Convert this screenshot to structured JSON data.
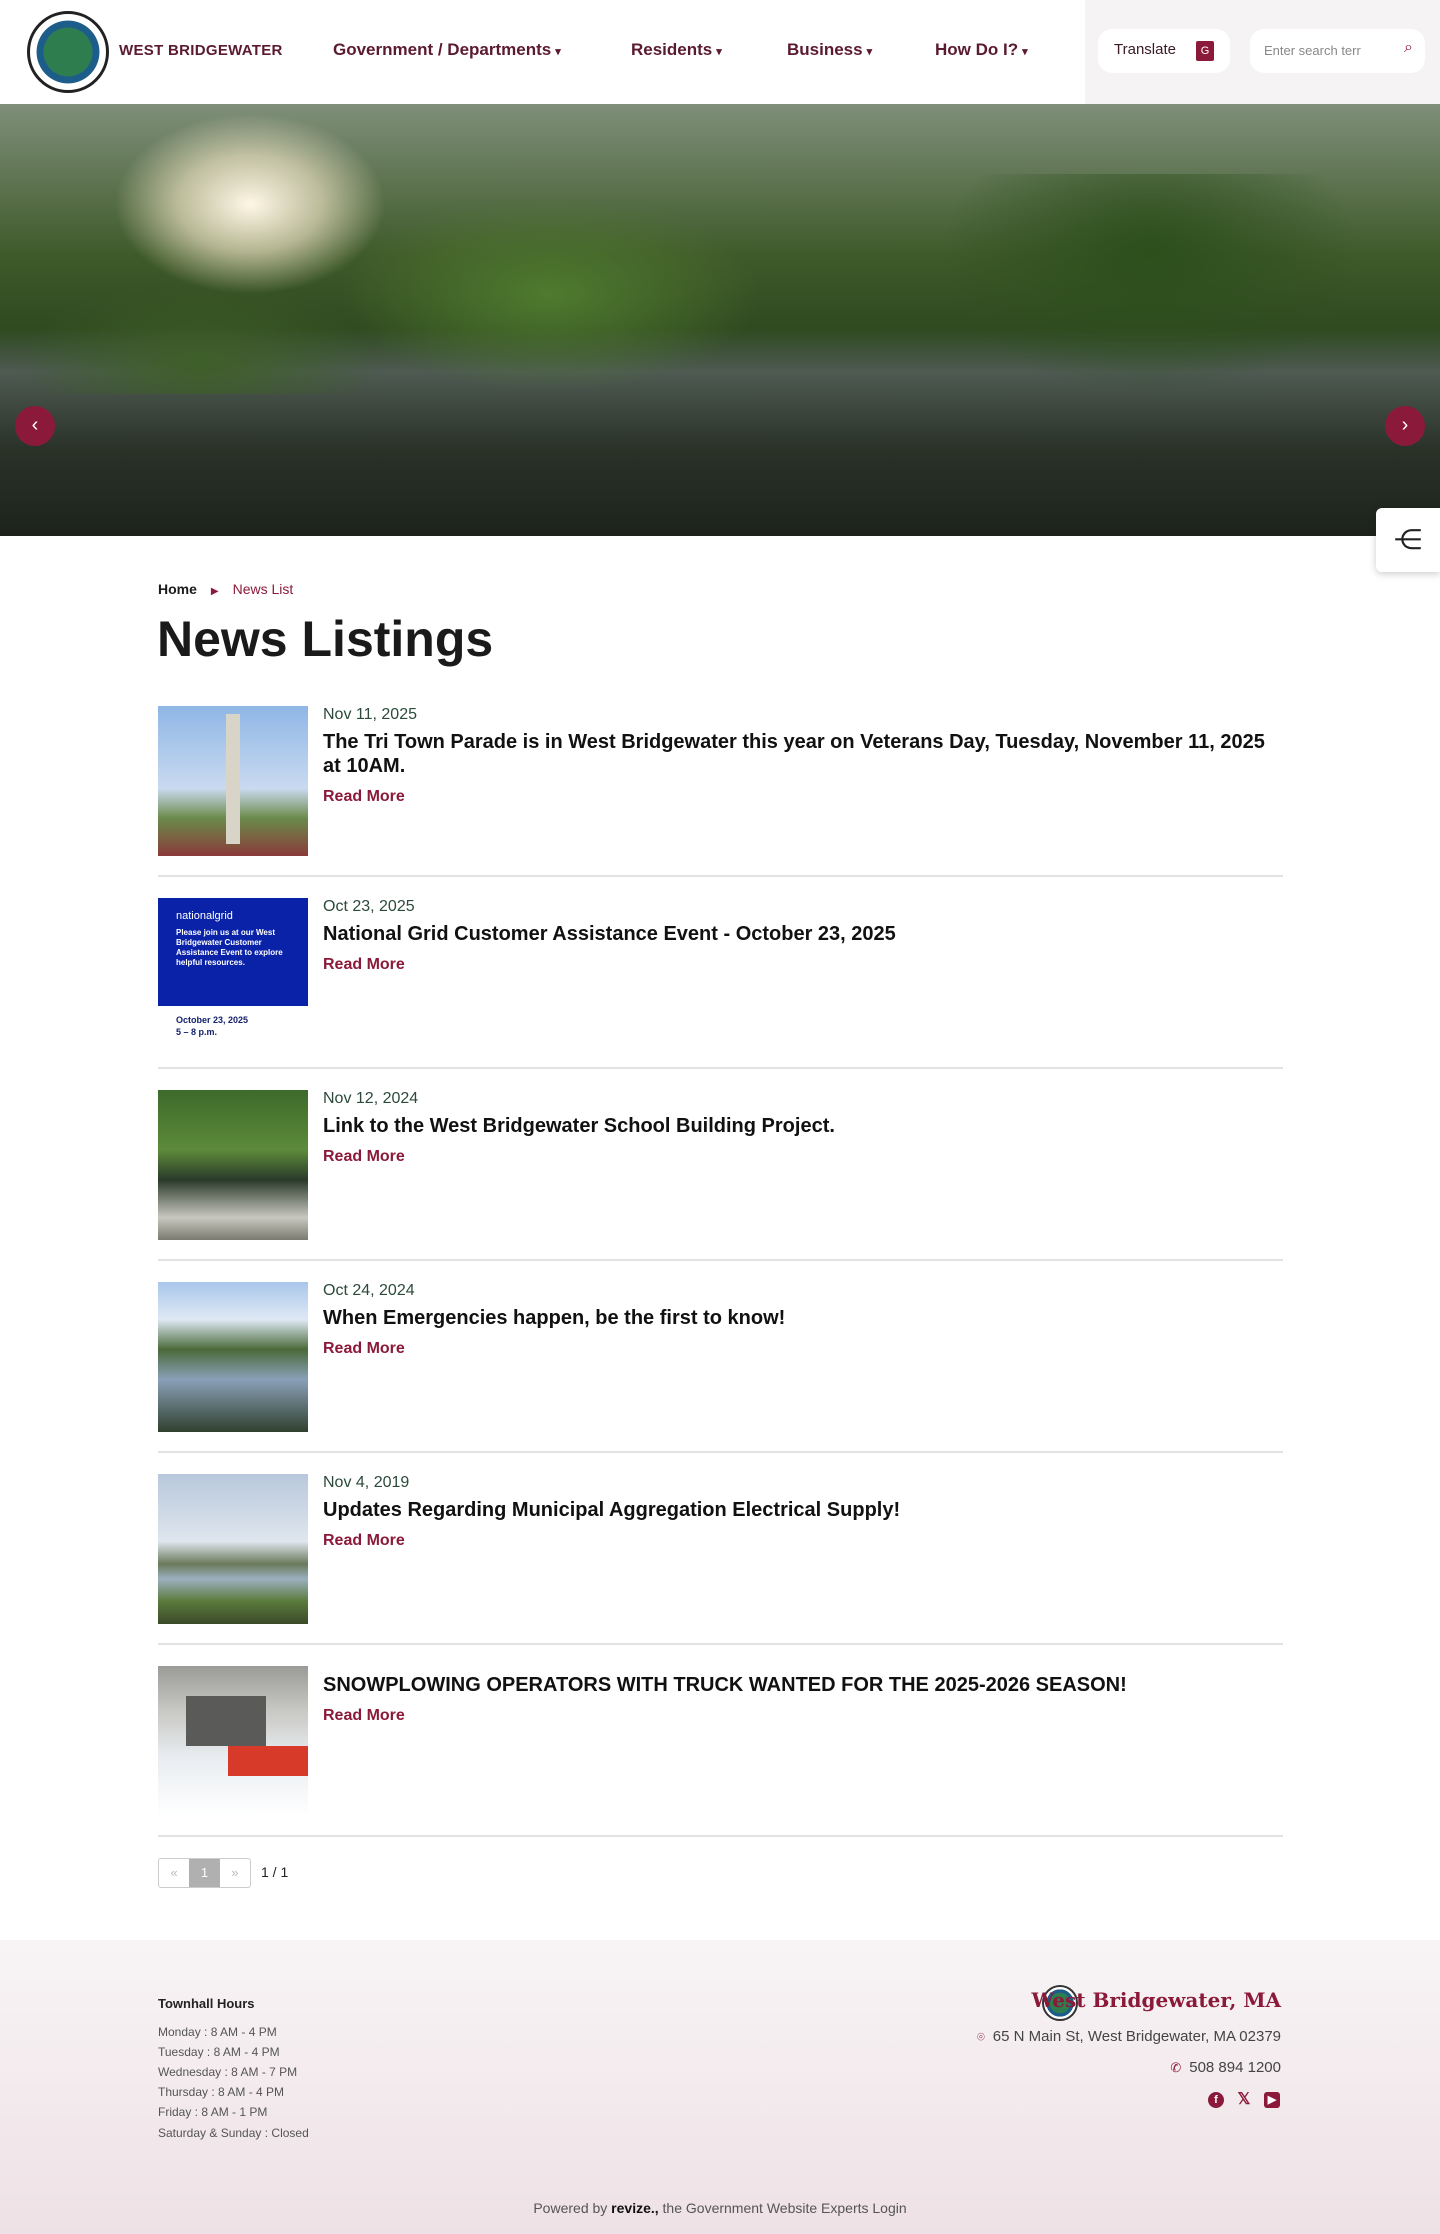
{
  "header": {
    "brand": "WEST BRIDGEWATER",
    "nav": [
      {
        "label": "Government / Departments"
      },
      {
        "label": "Residents"
      },
      {
        "label": "Business"
      },
      {
        "label": "How Do I?"
      }
    ],
    "translate": "Translate",
    "search_placeholder": "Enter search terr"
  },
  "breadcrumb": {
    "home": "Home",
    "current": "News List"
  },
  "page_title": "News Listings",
  "news": [
    {
      "date": "Nov 11, 2025",
      "title": "The Tri Town Parade is in West Bridgewater this year on Veterans Day, Tuesday, November 11, 2025 at 10AM.",
      "link": "Read More"
    },
    {
      "date": "Oct 23, 2025",
      "title": "National Grid Customer Assistance Event - October 23, 2025",
      "link": "Read More",
      "thumb_text": {
        "brand": "nationalgrid",
        "body": "Please join us at our West Bridgewater Customer Assistance Event to explore helpful resources.",
        "when": "October 23, 2025",
        "time": "5 – 8 p.m."
      }
    },
    {
      "date": "Nov 12, 2024",
      "title": "Link to the West Bridgewater School Building Project.",
      "link": "Read More"
    },
    {
      "date": "Oct 24, 2024",
      "title": "When Emergencies happen, be the first to know!",
      "link": "Read More"
    },
    {
      "date": "Nov 4, 2019",
      "title": "Updates Regarding Municipal Aggregation Electrical Supply!",
      "link": "Read More"
    },
    {
      "title": "SNOWPLOWING OPERATORS WITH TRUCK WANTED FOR THE 2025-2026 SEASON!",
      "link": "Read More"
    }
  ],
  "pagination": {
    "prev": "«",
    "current": "1",
    "next": "»",
    "count": "1 / 1"
  },
  "footer": {
    "hours_title": "Townhall Hours",
    "hours": [
      "Monday : 8 AM - 4 PM",
      "Tuesday : 8 AM - 4 PM",
      "Wednesday : 8 AM - 7 PM",
      "Thursday : 8 AM - 4 PM",
      "Friday : 8 AM - 1 PM",
      "Saturday & Sunday : Closed"
    ],
    "name": "West Bridgewater, MA",
    "address": "65 N Main St, West Bridgewater, MA 02379",
    "phone": "508 894 1200",
    "powered_pre": "Powered by",
    "powered_brand": "revize.,",
    "powered_post": "the Government Website Experts",
    "login": "Login"
  },
  "colors": {
    "accent": "#8b1a3a",
    "nav": "#5a1a30"
  }
}
